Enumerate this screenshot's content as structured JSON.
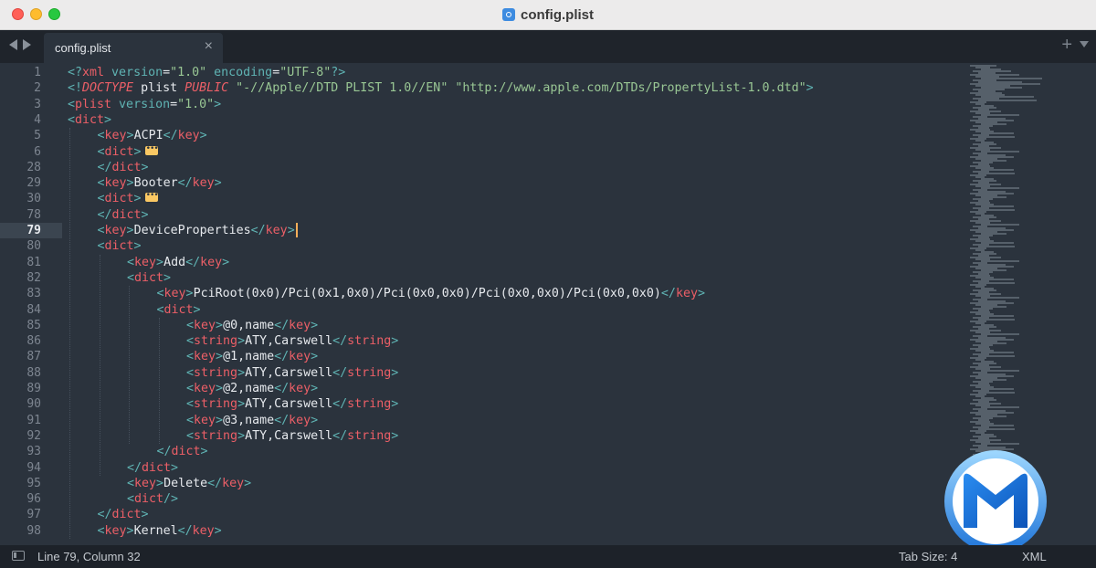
{
  "window": {
    "title": "config.plist"
  },
  "tabs": [
    {
      "label": "config.plist",
      "close": "×"
    }
  ],
  "tabbar": {
    "new_tab": "+"
  },
  "editor": {
    "active_line_number": "79",
    "lines": [
      {
        "n": "1",
        "indent": 0,
        "tokens": [
          [
            "pn",
            "<?"
          ],
          [
            "tg",
            "xml "
          ],
          [
            "kw",
            "version"
          ],
          [
            "tx",
            "="
          ],
          [
            "st",
            "\"1.0\""
          ],
          [
            "kw",
            " encoding"
          ],
          [
            "tx",
            "="
          ],
          [
            "st",
            "\"UTF-8\""
          ],
          [
            "pn",
            "?>"
          ]
        ]
      },
      {
        "n": "2",
        "indent": 0,
        "tokens": [
          [
            "pn",
            "<!"
          ],
          [
            "it",
            "DOCTYPE"
          ],
          [
            "tx",
            " plist "
          ],
          [
            "it",
            "PUBLIC"
          ],
          [
            "st",
            " \"-//Apple//DTD PLIST 1.0//EN\""
          ],
          [
            "st",
            " \"http://www.apple.com/DTDs/PropertyList-1.0.dtd\""
          ],
          [
            "pn",
            ">"
          ]
        ]
      },
      {
        "n": "3",
        "indent": 0,
        "tokens": [
          [
            "pn",
            "<"
          ],
          [
            "tg",
            "plist"
          ],
          [
            "kw",
            " version"
          ],
          [
            "tx",
            "="
          ],
          [
            "st",
            "\"1.0\""
          ],
          [
            "pn",
            ">"
          ]
        ]
      },
      {
        "n": "4",
        "indent": 0,
        "tokens": [
          [
            "pn",
            "<"
          ],
          [
            "tg",
            "dict"
          ],
          [
            "pn",
            ">"
          ]
        ]
      },
      {
        "n": "5",
        "indent": 1,
        "tokens": [
          [
            "pn",
            "<"
          ],
          [
            "tg",
            "key"
          ],
          [
            "pn",
            ">"
          ],
          [
            "tx",
            "ACPI"
          ],
          [
            "pn",
            "</"
          ],
          [
            "tg",
            "key"
          ],
          [
            "pn",
            ">"
          ]
        ]
      },
      {
        "n": "6",
        "indent": 1,
        "fold": true,
        "tokens": [
          [
            "pn",
            "<"
          ],
          [
            "tg",
            "dict"
          ],
          [
            "pn",
            ">"
          ]
        ]
      },
      {
        "n": "28",
        "indent": 1,
        "tokens": [
          [
            "pn",
            "</"
          ],
          [
            "tg",
            "dict"
          ],
          [
            "pn",
            ">"
          ]
        ]
      },
      {
        "n": "29",
        "indent": 1,
        "tokens": [
          [
            "pn",
            "<"
          ],
          [
            "tg",
            "key"
          ],
          [
            "pn",
            ">"
          ],
          [
            "tx",
            "Booter"
          ],
          [
            "pn",
            "</"
          ],
          [
            "tg",
            "key"
          ],
          [
            "pn",
            ">"
          ]
        ]
      },
      {
        "n": "30",
        "indent": 1,
        "fold": true,
        "tokens": [
          [
            "pn",
            "<"
          ],
          [
            "tg",
            "dict"
          ],
          [
            "pn",
            ">"
          ]
        ]
      },
      {
        "n": "78",
        "indent": 1,
        "tokens": [
          [
            "pn",
            "</"
          ],
          [
            "tg",
            "dict"
          ],
          [
            "pn",
            ">"
          ]
        ]
      },
      {
        "n": "79",
        "indent": 1,
        "caret": true,
        "tokens": [
          [
            "pn",
            "<"
          ],
          [
            "tg",
            "key"
          ],
          [
            "pn",
            ">"
          ],
          [
            "tx",
            "DeviceProperties"
          ],
          [
            "pn",
            "</"
          ],
          [
            "tg",
            "key"
          ],
          [
            "pn",
            ">"
          ]
        ]
      },
      {
        "n": "80",
        "indent": 1,
        "tokens": [
          [
            "pn",
            "<"
          ],
          [
            "tg",
            "dict"
          ],
          [
            "pn",
            ">"
          ]
        ]
      },
      {
        "n": "81",
        "indent": 2,
        "tokens": [
          [
            "pn",
            "<"
          ],
          [
            "tg",
            "key"
          ],
          [
            "pn",
            ">"
          ],
          [
            "tx",
            "Add"
          ],
          [
            "pn",
            "</"
          ],
          [
            "tg",
            "key"
          ],
          [
            "pn",
            ">"
          ]
        ]
      },
      {
        "n": "82",
        "indent": 2,
        "tokens": [
          [
            "pn",
            "<"
          ],
          [
            "tg",
            "dict"
          ],
          [
            "pn",
            ">"
          ]
        ]
      },
      {
        "n": "83",
        "indent": 3,
        "tokens": [
          [
            "pn",
            "<"
          ],
          [
            "tg",
            "key"
          ],
          [
            "pn",
            ">"
          ],
          [
            "tx",
            "PciRoot(0x0)/Pci(0x1,0x0)/Pci(0x0,0x0)/Pci(0x0,0x0)/Pci(0x0,0x0)"
          ],
          [
            "pn",
            "</"
          ],
          [
            "tg",
            "key"
          ],
          [
            "pn",
            ">"
          ]
        ]
      },
      {
        "n": "84",
        "indent": 3,
        "tokens": [
          [
            "pn",
            "<"
          ],
          [
            "tg",
            "dict"
          ],
          [
            "pn",
            ">"
          ]
        ]
      },
      {
        "n": "85",
        "indent": 4,
        "tokens": [
          [
            "pn",
            "<"
          ],
          [
            "tg",
            "key"
          ],
          [
            "pn",
            ">"
          ],
          [
            "tx",
            "@0,name"
          ],
          [
            "pn",
            "</"
          ],
          [
            "tg",
            "key"
          ],
          [
            "pn",
            ">"
          ]
        ]
      },
      {
        "n": "86",
        "indent": 4,
        "tokens": [
          [
            "pn",
            "<"
          ],
          [
            "tg",
            "string"
          ],
          [
            "pn",
            ">"
          ],
          [
            "tx",
            "ATY,Carswell"
          ],
          [
            "pn",
            "</"
          ],
          [
            "tg",
            "string"
          ],
          [
            "pn",
            ">"
          ]
        ]
      },
      {
        "n": "87",
        "indent": 4,
        "tokens": [
          [
            "pn",
            "<"
          ],
          [
            "tg",
            "key"
          ],
          [
            "pn",
            ">"
          ],
          [
            "tx",
            "@1,name"
          ],
          [
            "pn",
            "</"
          ],
          [
            "tg",
            "key"
          ],
          [
            "pn",
            ">"
          ]
        ]
      },
      {
        "n": "88",
        "indent": 4,
        "tokens": [
          [
            "pn",
            "<"
          ],
          [
            "tg",
            "string"
          ],
          [
            "pn",
            ">"
          ],
          [
            "tx",
            "ATY,Carswell"
          ],
          [
            "pn",
            "</"
          ],
          [
            "tg",
            "string"
          ],
          [
            "pn",
            ">"
          ]
        ]
      },
      {
        "n": "89",
        "indent": 4,
        "tokens": [
          [
            "pn",
            "<"
          ],
          [
            "tg",
            "key"
          ],
          [
            "pn",
            ">"
          ],
          [
            "tx",
            "@2,name"
          ],
          [
            "pn",
            "</"
          ],
          [
            "tg",
            "key"
          ],
          [
            "pn",
            ">"
          ]
        ]
      },
      {
        "n": "90",
        "indent": 4,
        "tokens": [
          [
            "pn",
            "<"
          ],
          [
            "tg",
            "string"
          ],
          [
            "pn",
            ">"
          ],
          [
            "tx",
            "ATY,Carswell"
          ],
          [
            "pn",
            "</"
          ],
          [
            "tg",
            "string"
          ],
          [
            "pn",
            ">"
          ]
        ]
      },
      {
        "n": "91",
        "indent": 4,
        "tokens": [
          [
            "pn",
            "<"
          ],
          [
            "tg",
            "key"
          ],
          [
            "pn",
            ">"
          ],
          [
            "tx",
            "@3,name"
          ],
          [
            "pn",
            "</"
          ],
          [
            "tg",
            "key"
          ],
          [
            "pn",
            ">"
          ]
        ]
      },
      {
        "n": "92",
        "indent": 4,
        "tokens": [
          [
            "pn",
            "<"
          ],
          [
            "tg",
            "string"
          ],
          [
            "pn",
            ">"
          ],
          [
            "tx",
            "ATY,Carswell"
          ],
          [
            "pn",
            "</"
          ],
          [
            "tg",
            "string"
          ],
          [
            "pn",
            ">"
          ]
        ]
      },
      {
        "n": "93",
        "indent": 3,
        "tokens": [
          [
            "pn",
            "</"
          ],
          [
            "tg",
            "dict"
          ],
          [
            "pn",
            ">"
          ]
        ]
      },
      {
        "n": "94",
        "indent": 2,
        "tokens": [
          [
            "pn",
            "</"
          ],
          [
            "tg",
            "dict"
          ],
          [
            "pn",
            ">"
          ]
        ]
      },
      {
        "n": "95",
        "indent": 2,
        "tokens": [
          [
            "pn",
            "<"
          ],
          [
            "tg",
            "key"
          ],
          [
            "pn",
            ">"
          ],
          [
            "tx",
            "Delete"
          ],
          [
            "pn",
            "</"
          ],
          [
            "tg",
            "key"
          ],
          [
            "pn",
            ">"
          ]
        ]
      },
      {
        "n": "96",
        "indent": 2,
        "tokens": [
          [
            "pn",
            "<"
          ],
          [
            "tg",
            "dict"
          ],
          [
            "pn",
            "/>"
          ]
        ]
      },
      {
        "n": "97",
        "indent": 1,
        "tokens": [
          [
            "pn",
            "</"
          ],
          [
            "tg",
            "dict"
          ],
          [
            "pn",
            ">"
          ]
        ]
      },
      {
        "n": "98",
        "indent": 1,
        "tokens": [
          [
            "pn",
            "<"
          ],
          [
            "tg",
            "key"
          ],
          [
            "pn",
            ">"
          ],
          [
            "tx",
            "Kernel"
          ],
          [
            "pn",
            "</"
          ],
          [
            "tg",
            "key"
          ],
          [
            "pn",
            ">"
          ]
        ]
      }
    ]
  },
  "status": {
    "position": "Line 79, Column 32",
    "tab_size": "Tab Size: 4",
    "syntax": "XML"
  },
  "colors": {
    "tag": "#ec5f67",
    "punct": "#5fb3b3",
    "string": "#99c794",
    "text": "#e6e9ed",
    "background": "#2b333d",
    "caret": "#f9ae58"
  },
  "icons": [
    "plist-file-icon",
    "back-arrow-icon",
    "forward-arrow-icon",
    "close-icon",
    "plus-icon",
    "chevron-down-icon",
    "fold-marker-icon",
    "sidebar-toggle-icon",
    "m-logo-icon"
  ]
}
